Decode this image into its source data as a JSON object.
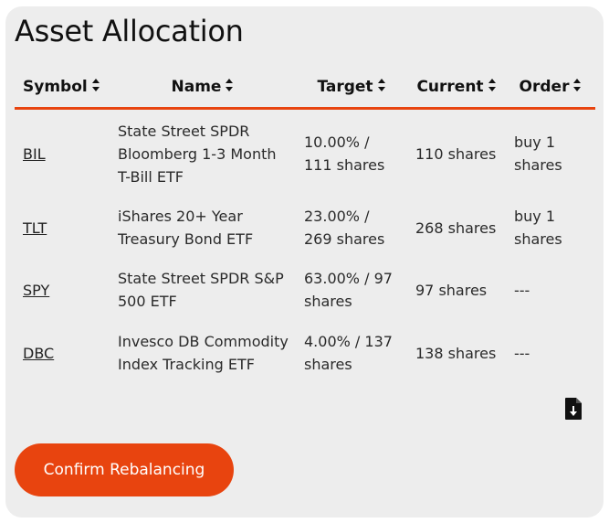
{
  "card": {
    "title": "Asset Allocation"
  },
  "table": {
    "headers": {
      "symbol": "Symbol",
      "name": "Name",
      "target": "Target",
      "current": "Current",
      "order": "Order"
    },
    "rows": [
      {
        "symbol": "BIL",
        "name": "State Street SPDR Bloomberg 1-3 Month T-Bill ETF",
        "target": "10.00% / 111 shares",
        "current": "110 shares",
        "order": "buy 1 shares"
      },
      {
        "symbol": "TLT",
        "name": "iShares 20+ Year Treasury Bond ETF",
        "target": "23.00% / 269 shares",
        "current": "268 shares",
        "order": "buy 1 shares"
      },
      {
        "symbol": "SPY",
        "name": "State Street SPDR S&P 500 ETF",
        "target": "63.00% / 97 shares",
        "current": "97 shares",
        "order": "---"
      },
      {
        "symbol": "DBC",
        "name": "Invesco DB Commodity Index Tracking ETF",
        "target": "4.00% / 137 shares",
        "current": "138 shares",
        "order": "---"
      }
    ]
  },
  "icons": {
    "download": "file-download-icon",
    "sort": "sort-arrows-icon"
  },
  "actions": {
    "confirm_label": "Confirm Rebalancing"
  },
  "colors": {
    "accent": "#e8440f",
    "card_bg": "#ededed",
    "text": "#222222"
  }
}
